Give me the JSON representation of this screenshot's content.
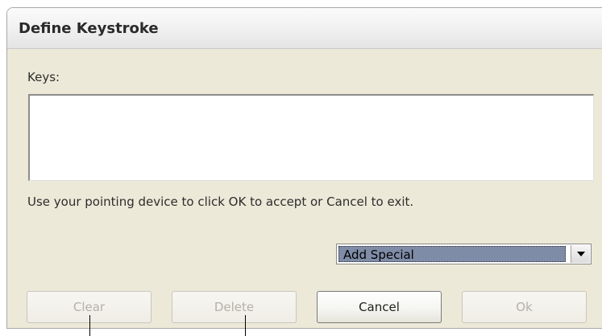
{
  "dialog": {
    "title": "Define Keystroke",
    "keys_label": "Keys:",
    "keys_value": "",
    "hint": "Use your pointing device to click OK to accept or Cancel to exit.",
    "special_select": {
      "selected": "Add Special"
    },
    "buttons": {
      "clear": "Clear",
      "delete": "Delete",
      "cancel": "Cancel",
      "ok": "Ok"
    }
  },
  "colors": {
    "dialog_background": "#ece9d8",
    "select_highlight": "#7f8ca8",
    "disabled_text": "#b3b1a8"
  },
  "icons": {
    "dropdown": "chevron-down-icon"
  }
}
